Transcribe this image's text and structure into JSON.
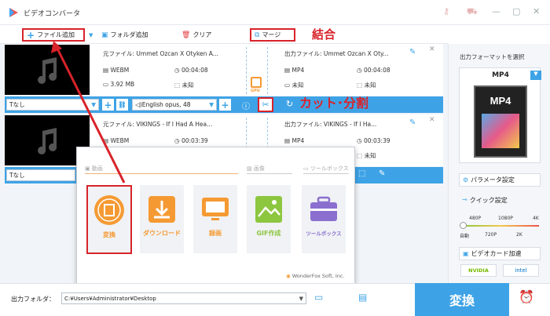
{
  "app": {
    "title": "ビデオコンバータ"
  },
  "toolbar": {
    "add_file": "ファイル追加",
    "add_folder": "フォルダ追加",
    "clear": "クリア",
    "merge": "マージ"
  },
  "annotations": {
    "merge": "結合",
    "cut": "カット･分割"
  },
  "files": [
    {
      "source_label": "元ファイル: Ummet Ozcan X Otyken  A...",
      "format": "WEBM",
      "duration": "00:04:08",
      "size": "3.92 MB",
      "resolution": "未知",
      "output_label": "出力ファイル: Ummet Ozcan X Oty...",
      "out_format": "MP4",
      "out_duration": "00:04:08",
      "out_size": "未知",
      "out_resolution": "未知",
      "subtitle": "なし",
      "audio": "English opus, 48",
      "gpu": "GPU"
    },
    {
      "source_label": "元ファイル: VIKINGS - If I Had A Hea...",
      "format": "WEBM",
      "duration": "00:03:39",
      "size": "",
      "resolution": "",
      "output_label": "出力ファイル: VIKINGS - If I Ha...",
      "out_format": "MP4",
      "out_duration": "00:03:39",
      "out_size": "未知",
      "out_resolution": "",
      "subtitle": "なし"
    }
  ],
  "popup": {
    "section_video": "動画",
    "section_image": "画像",
    "section_tools": "ツールボックス",
    "tiles": [
      "変換",
      "ダウンロード",
      "録画",
      "GIF作成",
      "ツールボックス"
    ],
    "footer": "WonderFox Soft, Inc."
  },
  "right": {
    "format_heading": "出力フォーマットを選択",
    "format": "MP4",
    "format_icon_text": "MP4",
    "param_settings": "パラメータ設定",
    "quick_settings": "クイック設定",
    "quality_top": [
      "480P",
      "1080P",
      "4K"
    ],
    "quality_bottom": [
      "自動",
      "720P",
      "2K"
    ],
    "gpu_accel": "ビデオカード加速",
    "nvidia": "NVIDIA",
    "intel": "intel"
  },
  "bottom": {
    "output_folder_label": "出力フォルダ：",
    "output_path": "C:¥Users¥Administrator¥Desktop",
    "convert_button": "変換"
  },
  "colors": {
    "accent": "#3ea3e6",
    "orange": "#f59a33",
    "annotation_red": "#d8232a",
    "green": "#8dc63f",
    "purple": "#8a6fcf"
  }
}
